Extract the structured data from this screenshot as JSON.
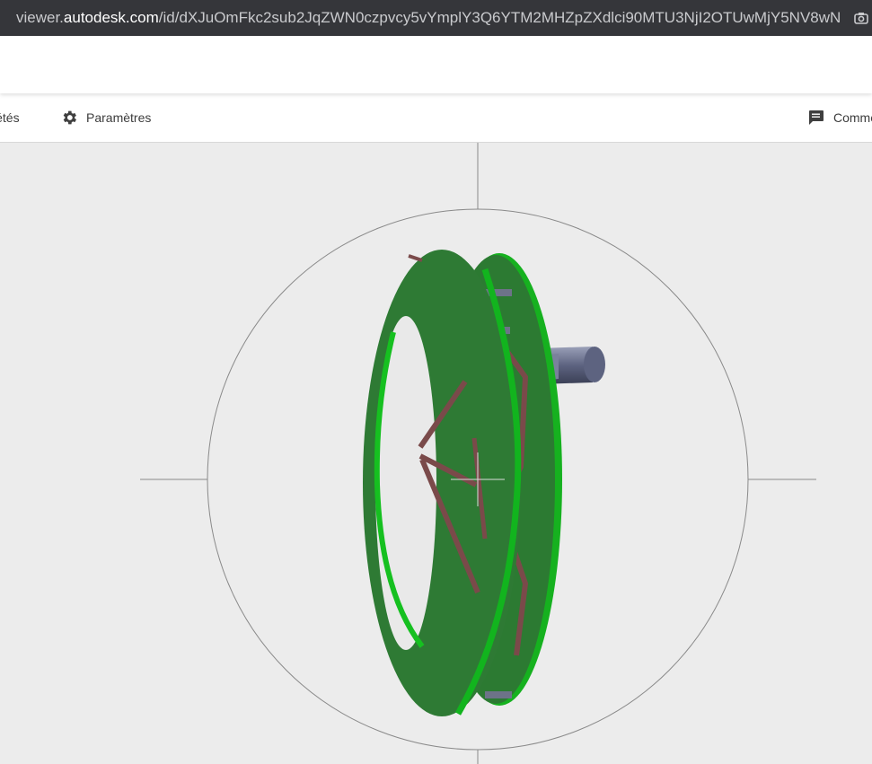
{
  "browser": {
    "url_host_prefix": "viewer.",
    "url_host": "autodesk.com",
    "url_path": "/id/dXJuOmFkc2sub2JqZWN0czpvcy5vYmplY3Q6YTM2MHZpZXdlci90MTU3NjI2OTUwMjY5NV8wN"
  },
  "toolbar": {
    "properties_label": "iétés",
    "settings_label": "Paramètres",
    "comments_label": "Comme"
  },
  "icons": {
    "settings": "gear-icon",
    "comments": "comment-icon",
    "screenshot": "camera-icon"
  },
  "colors": {
    "model_green": "#2f7a35",
    "model_edge_green": "#12b41e",
    "model_red_mark": "#7a4a4a",
    "viewer_bg": "#ececec"
  }
}
